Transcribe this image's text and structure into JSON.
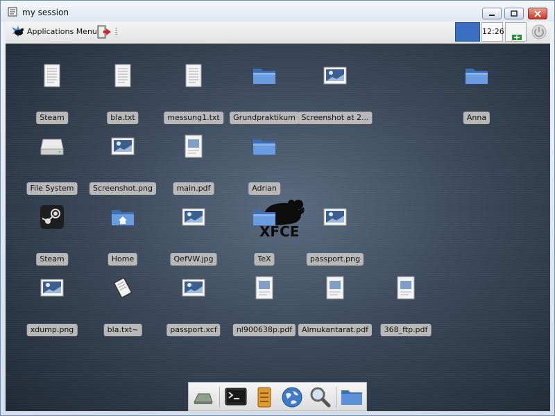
{
  "window": {
    "title": "my session"
  },
  "panel": {
    "applications_menu": "Applications Menu",
    "clock": "12:26"
  },
  "desktop": {
    "icons": [
      {
        "label": "Steam",
        "icon": "text-file-icon"
      },
      {
        "label": "bla.txt",
        "icon": "text-file-icon"
      },
      {
        "label": "messung1.txt",
        "icon": "text-file-icon"
      },
      {
        "label": "Grundpraktikum",
        "icon": "folder-icon"
      },
      {
        "label": "Screenshot at 2...",
        "icon": "image-file-icon"
      },
      {
        "label": "Anna",
        "icon": "folder-icon"
      },
      {
        "label": "File System",
        "icon": "drive-icon"
      },
      {
        "label": "Screenshot.png",
        "icon": "image-file-icon"
      },
      {
        "label": "main.pdf",
        "icon": "pdf-file-icon"
      },
      {
        "label": "Adrian",
        "icon": "folder-icon"
      },
      {
        "label": "Steam",
        "icon": "steam-icon"
      },
      {
        "label": "Home",
        "icon": "home-folder-icon"
      },
      {
        "label": "QefVW.jpg",
        "icon": "image-file-icon"
      },
      {
        "label": "TeX",
        "icon": "folder-icon"
      },
      {
        "label": "passport.png",
        "icon": "image-file-icon"
      },
      {
        "label": "xdump.png",
        "icon": "image-file-icon"
      },
      {
        "label": "bla.txt~",
        "icon": "backup-file-icon"
      },
      {
        "label": "passport.xcf",
        "icon": "image-file-icon"
      },
      {
        "label": "nl900638p.pdf",
        "icon": "pdf-file-icon"
      },
      {
        "label": "Almukantarat.pdf",
        "icon": "pdf-file-icon"
      },
      {
        "label": "368_ftp.pdf",
        "icon": "pdf-file-icon"
      }
    ]
  },
  "dock": {
    "items": [
      "show-desktop-icon",
      "terminal-icon",
      "file-manager-icon",
      "web-browser-icon",
      "search-icon",
      "folder-icon"
    ]
  },
  "colors": {
    "workspace_active": "#3b6fc2",
    "label_bg": "#b8b8b8",
    "folder_blue": "#5b8fd6"
  }
}
